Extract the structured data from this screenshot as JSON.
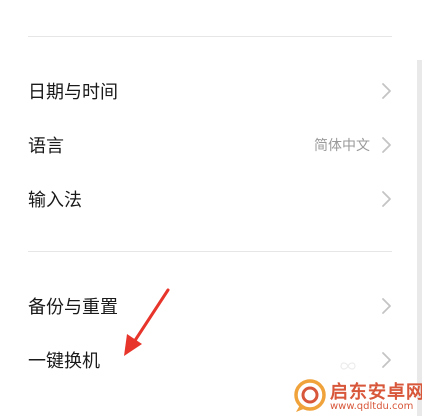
{
  "settings": {
    "items": [
      {
        "label": "日期与时间",
        "value": ""
      },
      {
        "label": "语言",
        "value": "简体中文"
      },
      {
        "label": "输入法",
        "value": ""
      },
      {
        "label": "备份与重置",
        "value": ""
      },
      {
        "label": "一键换机",
        "value": ""
      }
    ]
  },
  "watermark": {
    "title": "启东安卓网",
    "url": "www.qdltdu.com",
    "color": "#d8573a"
  },
  "colors": {
    "background": "#ffffff",
    "text": "#1a1a1a",
    "secondary_text": "#9a9a9a",
    "chevron": "#c4c4c4",
    "divider": "#e6e6e6",
    "annotation_arrow": "#e8352b"
  },
  "icons": {
    "chevron": "chevron-right-icon",
    "annotation": "red-arrow-icon",
    "watermark_logo": "speech-bubble-logo-icon"
  }
}
